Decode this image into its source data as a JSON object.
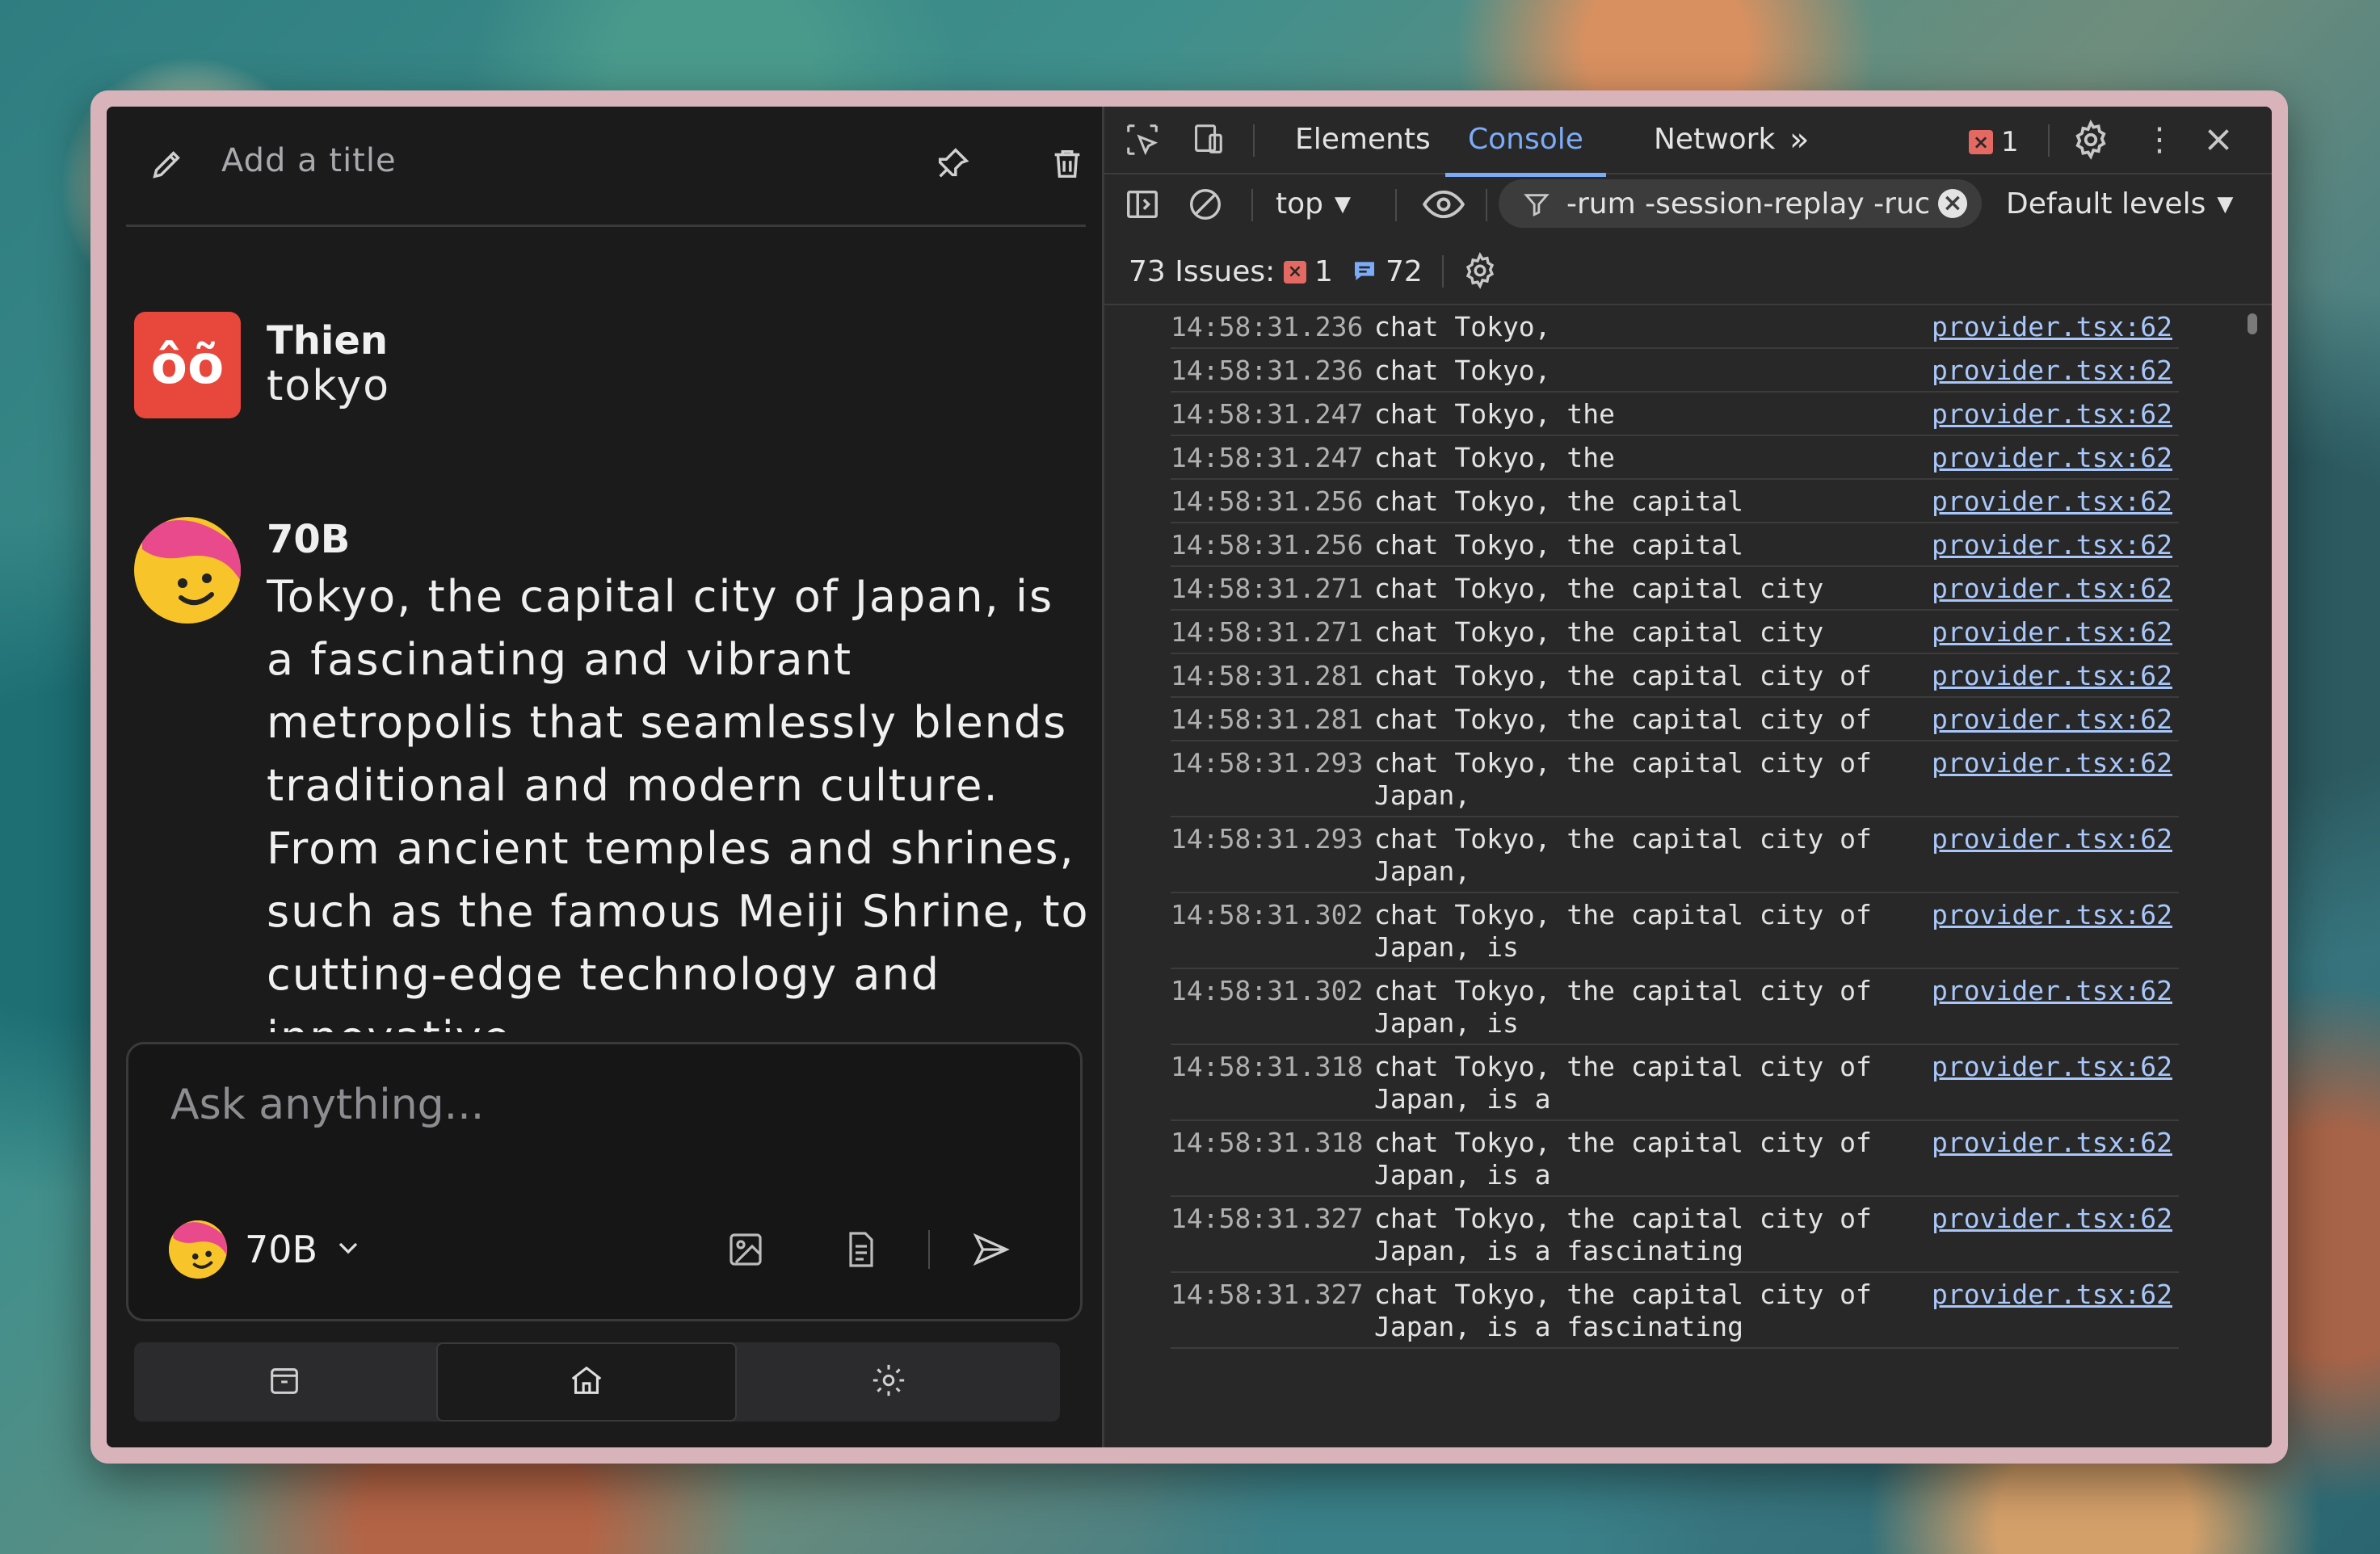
{
  "app": {
    "title_placeholder": "Add a title",
    "messages": [
      {
        "author": "Thien",
        "avatar_text": "ôõ",
        "text": "tokyo"
      },
      {
        "author": "70B",
        "text": "Tokyo, the capital city of Japan, is a fascinating and vibrant metropolis that seamlessly blends traditional and modern culture. From ancient temples and shrines, such as the famous Meiji Shrine, to cutting-edge technology and innovative"
      }
    ],
    "composer": {
      "placeholder": "Ask anything...",
      "model_label": "70B"
    }
  },
  "devtools": {
    "tabs": [
      "Elements",
      "Console",
      "Network"
    ],
    "active_tab": "Console",
    "error_count": "1",
    "context": "top",
    "filter_text": "-rum -session-replay -ruc",
    "levels": "Default levels",
    "issues": {
      "label": "73 Issues:",
      "errors": "1",
      "infos": "72"
    },
    "logs": [
      {
        "ts": "14:58:31.236",
        "msg": "chat Tokyo,",
        "src": "provider.tsx:62"
      },
      {
        "ts": "14:58:31.236",
        "msg": "chat Tokyo,",
        "src": "provider.tsx:62"
      },
      {
        "ts": "14:58:31.247",
        "msg": "chat Tokyo, the",
        "src": "provider.tsx:62"
      },
      {
        "ts": "14:58:31.247",
        "msg": "chat Tokyo, the",
        "src": "provider.tsx:62"
      },
      {
        "ts": "14:58:31.256",
        "msg": "chat Tokyo, the capital",
        "src": "provider.tsx:62"
      },
      {
        "ts": "14:58:31.256",
        "msg": "chat Tokyo, the capital",
        "src": "provider.tsx:62"
      },
      {
        "ts": "14:58:31.271",
        "msg": "chat Tokyo, the capital city",
        "src": "provider.tsx:62"
      },
      {
        "ts": "14:58:31.271",
        "msg": "chat Tokyo, the capital city",
        "src": "provider.tsx:62"
      },
      {
        "ts": "14:58:31.281",
        "msg": "chat Tokyo, the capital city of",
        "src": "provider.tsx:62"
      },
      {
        "ts": "14:58:31.281",
        "msg": "chat Tokyo, the capital city of",
        "src": "provider.tsx:62"
      },
      {
        "ts": "14:58:31.293",
        "msg": "chat Tokyo, the capital city of\nJapan,",
        "src": "provider.tsx:62"
      },
      {
        "ts": "14:58:31.293",
        "msg": "chat Tokyo, the capital city of\nJapan,",
        "src": "provider.tsx:62"
      },
      {
        "ts": "14:58:31.302",
        "msg": "chat Tokyo, the capital city of\nJapan, is",
        "src": "provider.tsx:62"
      },
      {
        "ts": "14:58:31.302",
        "msg": "chat Tokyo, the capital city of\nJapan, is",
        "src": "provider.tsx:62"
      },
      {
        "ts": "14:58:31.318",
        "msg": "chat Tokyo, the capital city of\nJapan, is a",
        "src": "provider.tsx:62"
      },
      {
        "ts": "14:58:31.318",
        "msg": "chat Tokyo, the capital city of\nJapan, is a",
        "src": "provider.tsx:62"
      },
      {
        "ts": "14:58:31.327",
        "msg": "chat Tokyo, the capital city of\nJapan, is a fascinating",
        "src": "provider.tsx:62"
      },
      {
        "ts": "14:58:31.327",
        "msg": "chat Tokyo, the capital city of\nJapan, is a fascinating",
        "src": "provider.tsx:62"
      }
    ]
  }
}
